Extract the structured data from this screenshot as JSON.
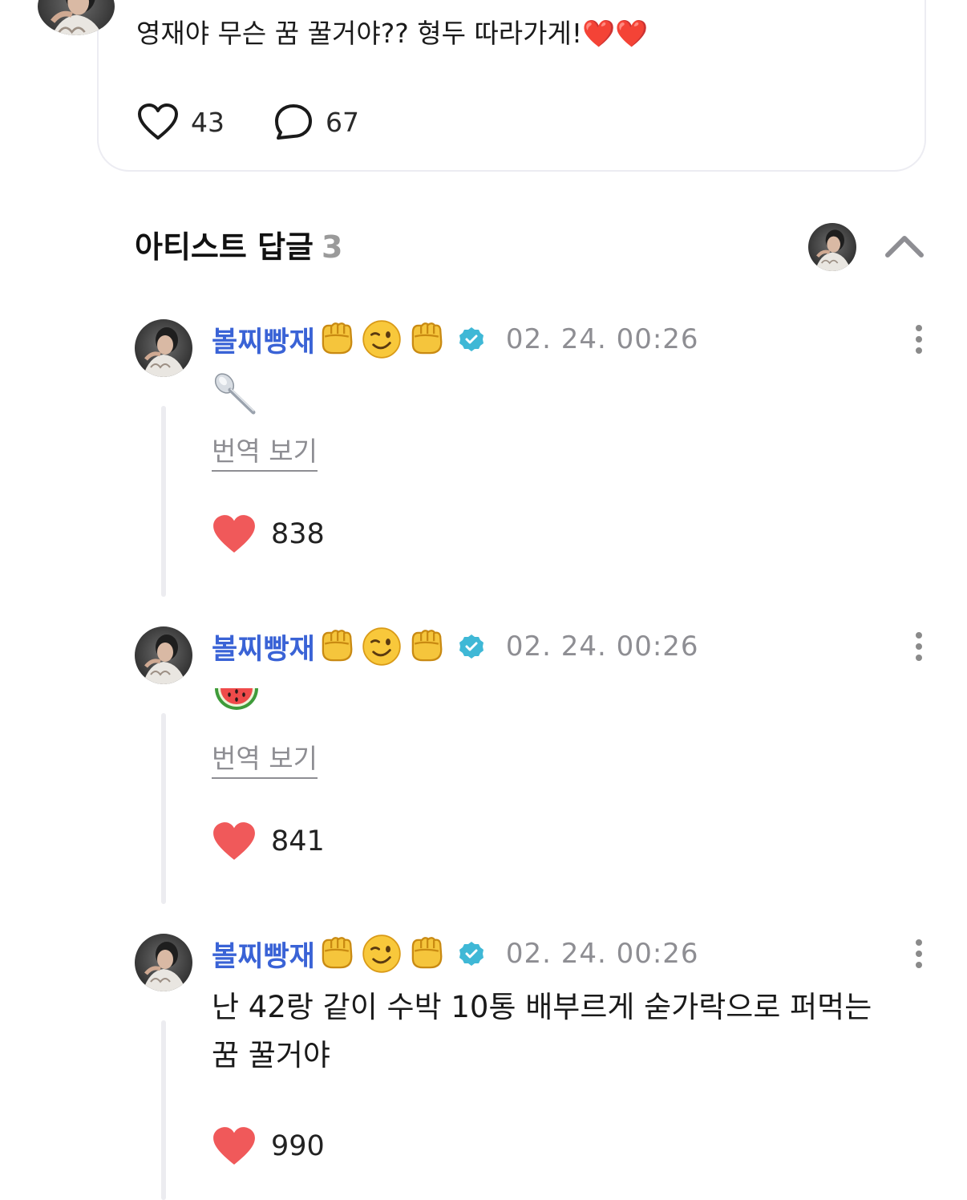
{
  "post": {
    "text": "영재야 무슨 꿈 꿀거야?? 형두 따라가게!❤️❤️",
    "likes": "43",
    "comments": "67"
  },
  "section": {
    "title": "아티스트 답글",
    "count": "3"
  },
  "comments": [
    {
      "name": "볼찌빵재",
      "date": "02. 24. 00:26",
      "body_emoji": "spoon",
      "translate": "번역 보기",
      "likes": "838"
    },
    {
      "name": "볼찌빵재",
      "date": "02. 24. 00:26",
      "body_emoji": "watermelon",
      "translate": "번역 보기",
      "likes": "841"
    },
    {
      "name": "볼찌빵재",
      "date": "02. 24. 00:26",
      "text": "난 42랑 같이 수박 10통 배부르게 숟가락으로 퍼먹는 꿈 꿀거야",
      "likes": "990"
    }
  ],
  "name_emojis": [
    "raised-fist",
    "winking-face",
    "raised-fist"
  ],
  "icons": {
    "like_outline": "heart-outline-icon",
    "comment": "speech-bubble-icon",
    "like_filled": "heart-filled-icon",
    "verified": "verified-badge-icon",
    "more": "more-vertical-icon",
    "collapse": "chevron-up-icon"
  },
  "colors": {
    "name": "#3a63d6",
    "heart": "#f0595a",
    "verified": "#3fb8d6",
    "muted": "#8e8e93"
  }
}
